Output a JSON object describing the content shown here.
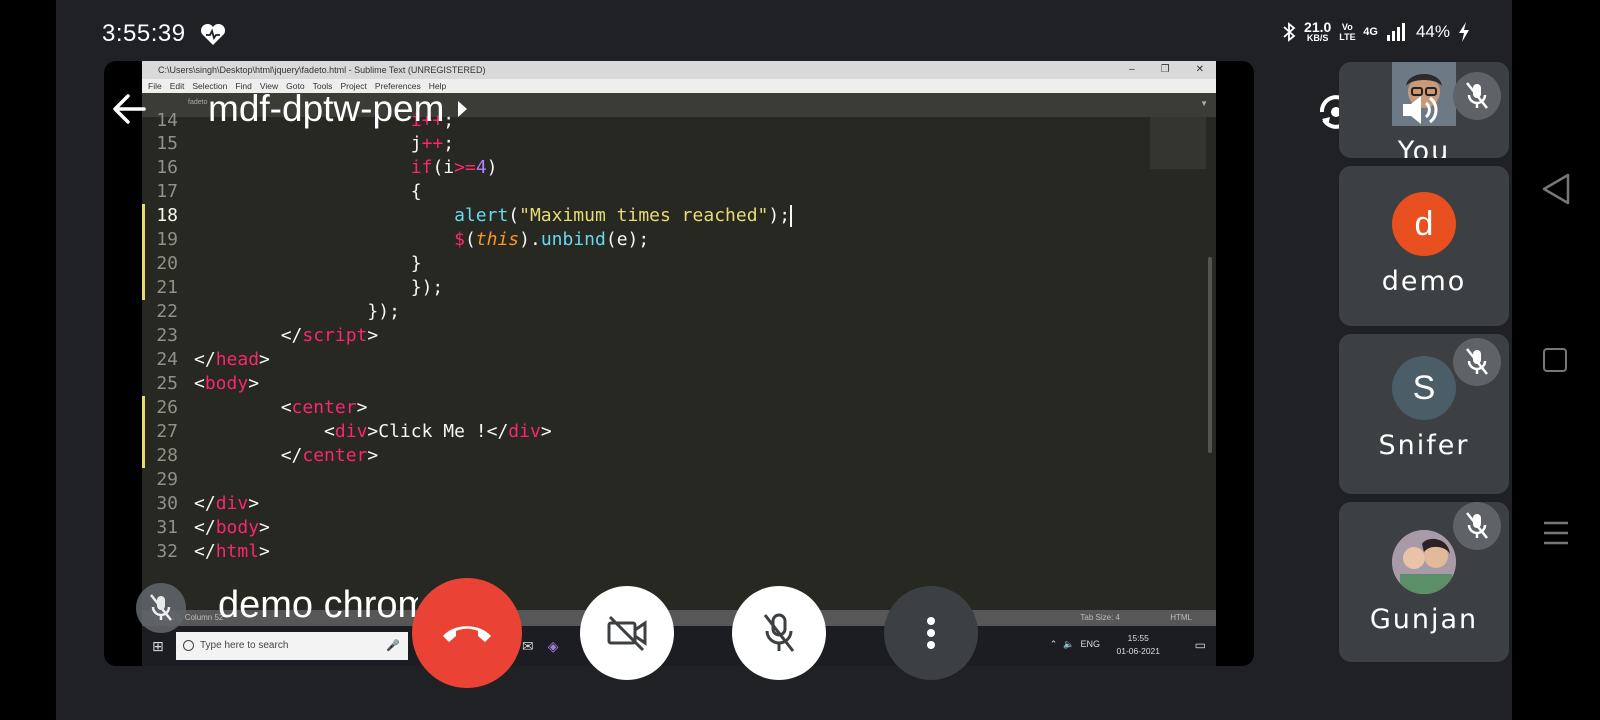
{
  "status": {
    "time": "3:55:39",
    "net_speed": "21.0",
    "net_unit": "KB/S",
    "volte": "Vo LTE",
    "network": "4G",
    "battery": "44%"
  },
  "meeting": {
    "code": "mdf-dptw-pem",
    "presenter_name": "demo chrome"
  },
  "shared_screen": {
    "window_title": "C:\\Users\\singh\\Desktop\\html\\jquery\\fadeto.html - Sublime Text (UNREGISTERED)",
    "menu": [
      "File",
      "Edit",
      "Selection",
      "Find",
      "View",
      "Goto",
      "Tools",
      "Project",
      "Preferences",
      "Help"
    ],
    "tab_name": "fadeto",
    "status_left": "Line 18, Column 52",
    "tab_size": "Tab Size: 4",
    "syntax": "HTML",
    "taskbar_search": "Type here to search",
    "tray_lang": "ENG",
    "clock_time": "15:55",
    "clock_date": "01-06-2021"
  },
  "participants": [
    {
      "name": "You",
      "initial": "",
      "avatar_color": "#5f6368",
      "muted": true
    },
    {
      "name": "demo",
      "initial": "d",
      "avatar_color": "#e8501f",
      "muted": false
    },
    {
      "name": "Snifer",
      "initial": "S",
      "avatar_color": "#4b5d67",
      "muted": true
    },
    {
      "name": "Gunjan",
      "initial": "",
      "avatar_color": "#7a6a8a",
      "muted": true
    }
  ],
  "colors": {
    "end_call": "#ea4335",
    "background": "#202124",
    "tile": "#3c4043"
  }
}
